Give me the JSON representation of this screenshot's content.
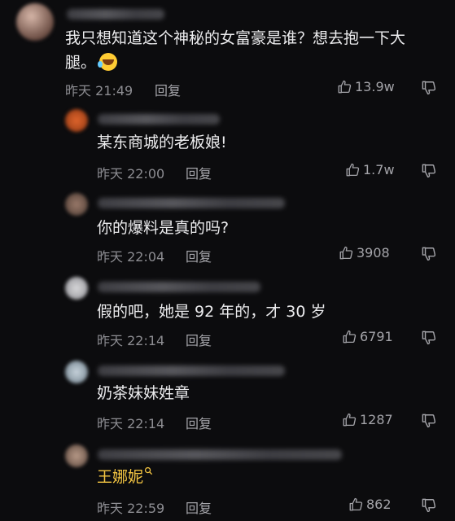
{
  "comments": [
    {
      "text": "我只想知道这个神秘的女富豪是谁？想去抱一下大\n腿。",
      "time": "昨天 21:49",
      "reply": "回复",
      "likes": "13.9w"
    },
    {
      "text": "某东商城的老板娘!",
      "time": "昨天 22:00",
      "reply": "回复",
      "likes": "1.7w"
    },
    {
      "text": "你的爆料是真的吗?",
      "time": "昨天 22:04",
      "reply": "回复",
      "likes": "3908"
    },
    {
      "text": "假的吧，她是 92 年的，才 30 岁",
      "time": "昨天 22:14",
      "reply": "回复",
      "likes": "6791"
    },
    {
      "text": "奶茶妹妹姓章",
      "time": "昨天 22:14",
      "reply": "回复",
      "likes": "1287"
    },
    {
      "text": "王娜妮",
      "time": "昨天 22:59",
      "reply": "回复",
      "likes": "862"
    }
  ],
  "icons": {
    "like": "thumbs-up-icon",
    "dislike": "thumbs-down-icon",
    "search": "search-icon",
    "emoji": "laughing-emoji-icon"
  },
  "colors": {
    "background": "#0c0c0e",
    "highlight": "#f4c542",
    "meta": "#8d8d92"
  }
}
